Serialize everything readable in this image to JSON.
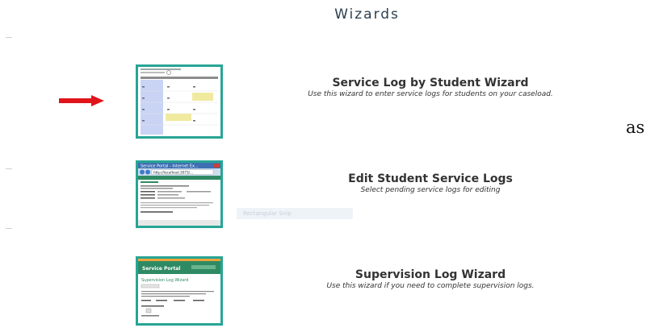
{
  "page": {
    "title": "Wizards"
  },
  "wizards": [
    {
      "title": "Service Log by Student Wizard",
      "description": "Use this wizard to enter service logs for students on your caseload."
    },
    {
      "title": "Edit Student Service Logs",
      "description": "Select pending service logs for editing"
    },
    {
      "title": "Supervision Log Wizard",
      "description": "Use this wizard if you need to complete supervision logs."
    }
  ],
  "thumbnails": {
    "edit_logs": {
      "window_title": "Service Portal - Internet Ex...",
      "address": "http://localhost:3073/..."
    },
    "supervision": {
      "app_name": "Service Portal",
      "heading": "Supervision Log Wizard"
    }
  },
  "side_text": "as",
  "ghost_overlay": "Rectangular Snip",
  "colors": {
    "thumb_border": "#27a595",
    "arrow": "#e0141b",
    "title": "#2a3f4f"
  }
}
